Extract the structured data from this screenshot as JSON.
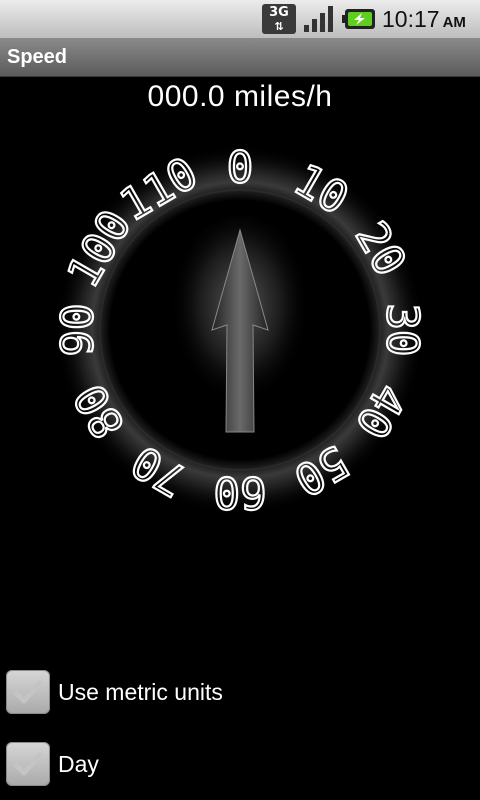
{
  "status_bar": {
    "network_type": "3G",
    "network_arrows": "⇅",
    "time": "10:17",
    "ampm": "AM",
    "icons": [
      "3g-icon",
      "signal-icon",
      "battery-charging-icon"
    ]
  },
  "title_bar": {
    "title": "Speed"
  },
  "speed": {
    "readout": "000.0 miles/h",
    "value": 0
  },
  "dial": {
    "labels": [
      "0",
      "10",
      "20",
      "30",
      "40",
      "50",
      "60",
      "70",
      "80",
      "90",
      "100",
      "110"
    ]
  },
  "options": [
    {
      "label": "Use metric units",
      "checked": false
    },
    {
      "label": "Day",
      "checked": false
    }
  ]
}
